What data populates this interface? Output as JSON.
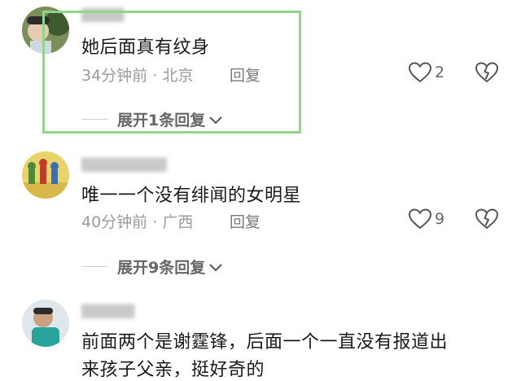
{
  "comments": [
    {
      "text": "她后面真有纹身",
      "time": "34分钟前",
      "sep": " · ",
      "location": "北京",
      "reply_label": "回复",
      "likes": "2",
      "expand_label": "展开1条回复"
    },
    {
      "text": "唯一一个没有绯闻的女明星",
      "time": "40分钟前",
      "sep": " · ",
      "location": "广西",
      "reply_label": "回复",
      "likes": "9",
      "expand_label": "展开9条回复"
    },
    {
      "text_line1": "前面两个是谢霆锋，后面一个一直没有报道出",
      "text_line2": "来孩子父亲，挺好奇的"
    }
  ],
  "colors": {
    "highlight": "#8fd68a",
    "meta": "#9b9b9b",
    "text": "#1a1a1a"
  }
}
